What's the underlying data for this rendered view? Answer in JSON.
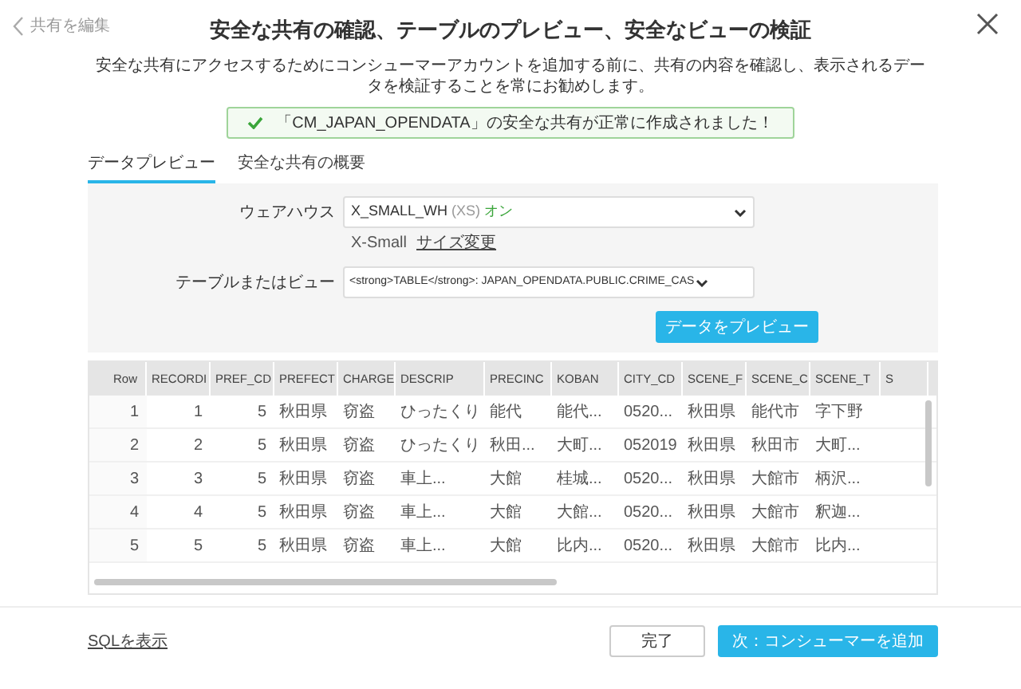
{
  "header": {
    "back_link": "共有を編集",
    "title": "安全な共有の確認、テーブルのプレビュー、安全なビューの検証",
    "subtitle": "安全な共有にアクセスするためにコンシューマーアカウントを追加する前に、共有の内容を確認し、表示されるデータを検証することを常にお勧めします。"
  },
  "alert": {
    "kind": "success",
    "message": "「CM_JAPAN_OPENDATA」の安全な共有が正常に作成されました！"
  },
  "tabs": [
    {
      "label": "データプレビュー",
      "selected": true
    },
    {
      "label": "安全な共有の概要",
      "selected": false
    }
  ],
  "form": {
    "warehouse": {
      "label": "ウェアハウス",
      "name": "X_SMALL_WH",
      "size": "(XS)",
      "status": "オン",
      "size_label": "X-Small",
      "resize_link": "サイズ変更"
    },
    "table_or_view": {
      "label": "テーブルまたはビュー",
      "value": "<strong>TABLE</strong>: JAPAN_OPENDATA.PUBLIC.CRIME_CAS"
    },
    "preview_button": "データをプレビュー"
  },
  "table": {
    "columns": [
      "Row",
      "RECORDI",
      "PREF_CD",
      "PREFECT",
      "CHARGE",
      "DESCRIP",
      "PRECINC",
      "KOBAN",
      "CITY_CD",
      "SCENE_F",
      "SCENE_C",
      "SCENE_T",
      "S"
    ],
    "rows": [
      [
        "1",
        "1",
        "5",
        "秋田県",
        "窃盗",
        "ひったくり",
        "能代",
        "能代...",
        "0520...",
        "秋田県",
        "能代市",
        "字下野"
      ],
      [
        "2",
        "2",
        "5",
        "秋田県",
        "窃盗",
        "ひったくり",
        "秋田...",
        "大町...",
        "052019",
        "秋田県",
        "秋田市",
        "大町..."
      ],
      [
        "3",
        "3",
        "5",
        "秋田県",
        "窃盗",
        "車上...",
        "大館",
        "桂城...",
        "0520...",
        "秋田県",
        "大館市",
        "柄沢..."
      ],
      [
        "4",
        "4",
        "5",
        "秋田県",
        "窃盗",
        "車上...",
        "大館",
        "大館...",
        "0520...",
        "秋田県",
        "大館市",
        "釈迦..."
      ],
      [
        "5",
        "5",
        "5",
        "秋田県",
        "窃盗",
        "車上...",
        "大館",
        "比内...",
        "0520...",
        "秋田県",
        "大館市",
        "比内..."
      ]
    ]
  },
  "footer": {
    "sql_link": "SQLを表示",
    "buttons": [
      {
        "label": "完了",
        "kind": "secondary"
      },
      {
        "label": "次：コンシューマーを追加",
        "kind": "primary"
      }
    ]
  }
}
